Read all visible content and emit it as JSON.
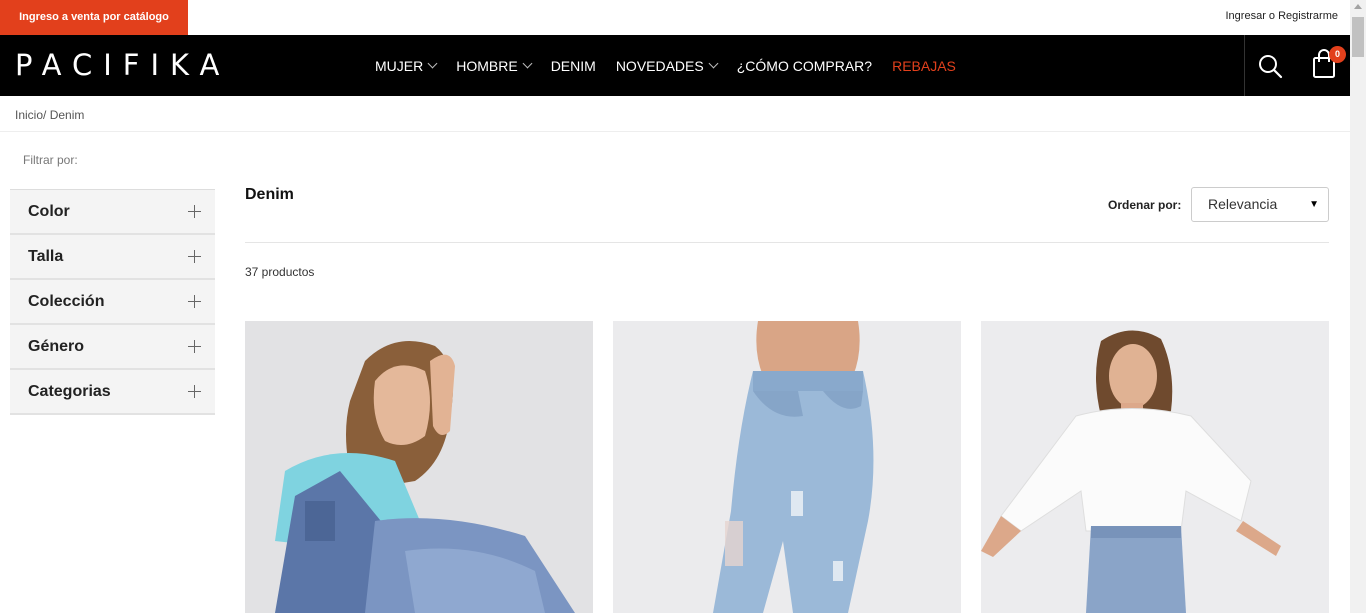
{
  "topbar": {
    "catalog_button": "Ingreso a venta por catálogo",
    "login": "Ingresar",
    "login_sep": " o ",
    "register": "Registrarme"
  },
  "header": {
    "logo": "PACIFIKA",
    "nav": [
      {
        "label": "MUJER",
        "dropdown": true
      },
      {
        "label": "HOMBRE",
        "dropdown": true
      },
      {
        "label": "DENIM",
        "dropdown": false
      },
      {
        "label": "NOVEDADES",
        "dropdown": true
      },
      {
        "label": "¿CÓMO COMPRAR?",
        "dropdown": false
      },
      {
        "label": "REBAJAS",
        "dropdown": false
      }
    ],
    "cart_count": "0",
    "search_icon": "search-icon",
    "cart_icon": "shopping-bag-icon"
  },
  "breadcrumb": {
    "home": "Inicio",
    "separator": "/ ",
    "current": "Denim"
  },
  "sidebar": {
    "title": "Filtrar por:",
    "filters": [
      {
        "label": "Color"
      },
      {
        "label": "Talla"
      },
      {
        "label": "Colección"
      },
      {
        "label": "Género"
      },
      {
        "label": "Categorias"
      }
    ]
  },
  "main": {
    "title": "Denim",
    "sort_label": "Ordenar por:",
    "sort_value": "Relevancia",
    "product_count": "37 productos"
  },
  "colors": {
    "accent": "#e2401c",
    "header_bg": "#000000"
  }
}
